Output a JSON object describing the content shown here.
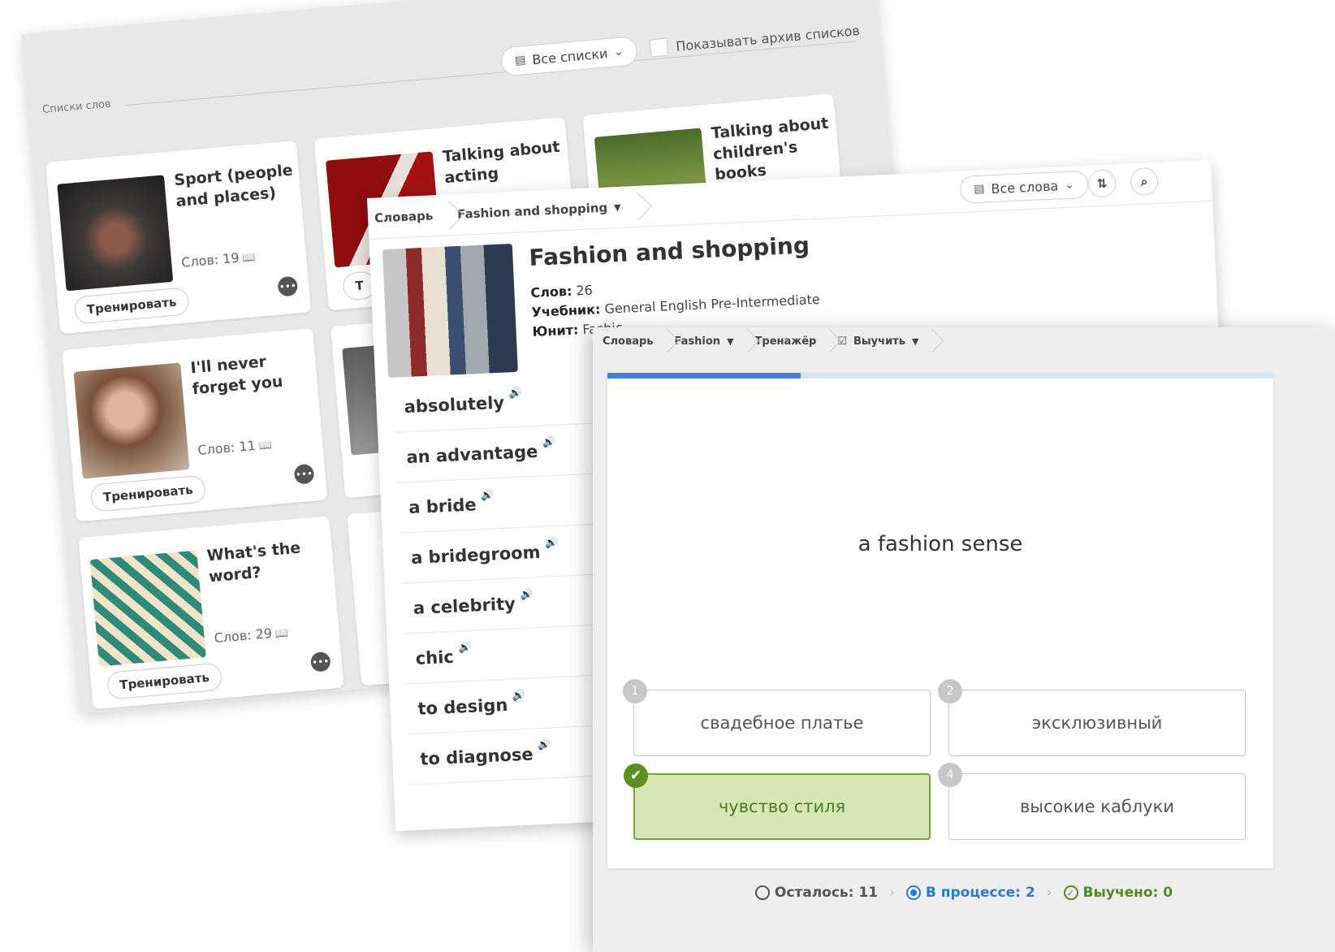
{
  "lists_panel": {
    "section_label": "Списки слов",
    "filter_label": "Все списки",
    "filter_icon": "list-icon",
    "archive_label": "Показывать архив списков",
    "cards": [
      {
        "title": "Sport (people and places)",
        "count": "Слов: 19",
        "train": "Тренировать"
      },
      {
        "title": "Talking about acting",
        "count": "",
        "train": "Т"
      },
      {
        "title": "Talking about children's books",
        "count": "",
        "train": ""
      },
      {
        "title": "I'll never forget you",
        "count": "Слов: 11",
        "train": "Тренировать"
      },
      {
        "title": "What's the word?",
        "count": "Слов: 29",
        "train": "Тренировать"
      }
    ]
  },
  "dictionary_panel": {
    "breadcrumb": {
      "root": "Словарь",
      "current": "Fashion and shopping"
    },
    "filter_label": "Все слова",
    "sort_icon": "sort-az-icon",
    "search_icon": "search-icon",
    "title": "Fashion and shopping",
    "words_label": "Слов:",
    "words_value": "26",
    "textbook_label": "Учебник:",
    "textbook_value": "General English Pre-Intermediate",
    "unit_label": "Юнит:",
    "unit_value": "Fashic",
    "words": [
      "absolutely",
      "an advantage",
      "a bride",
      "a bridegroom",
      "a celebrity",
      "chic",
      "to design",
      "to diagnose"
    ]
  },
  "trainer_panel": {
    "breadcrumb": {
      "root": "Словарь",
      "list": "Fashion",
      "section": "Тренажёр",
      "mode": "Выучить"
    },
    "progress": 0.29,
    "prompt": "a fashion sense",
    "answers": [
      {
        "num": "1",
        "text": "свадебное платье",
        "correct": false
      },
      {
        "num": "2",
        "text": "эксклюзивный",
        "correct": false
      },
      {
        "num": "",
        "text": "чувство стиля",
        "correct": true
      },
      {
        "num": "4",
        "text": "высокие каблуки",
        "correct": false
      }
    ],
    "status": {
      "remaining": "Осталось: 11",
      "in_progress": "В процессе: 2",
      "learned": "Выучено: 0"
    },
    "colors": {
      "progress": "#3b86dc",
      "correct_bg": "#d6e6b5",
      "correct_border": "#78a33c",
      "in_progress": "#2c7bd3",
      "learned": "#4f8b1f"
    }
  }
}
